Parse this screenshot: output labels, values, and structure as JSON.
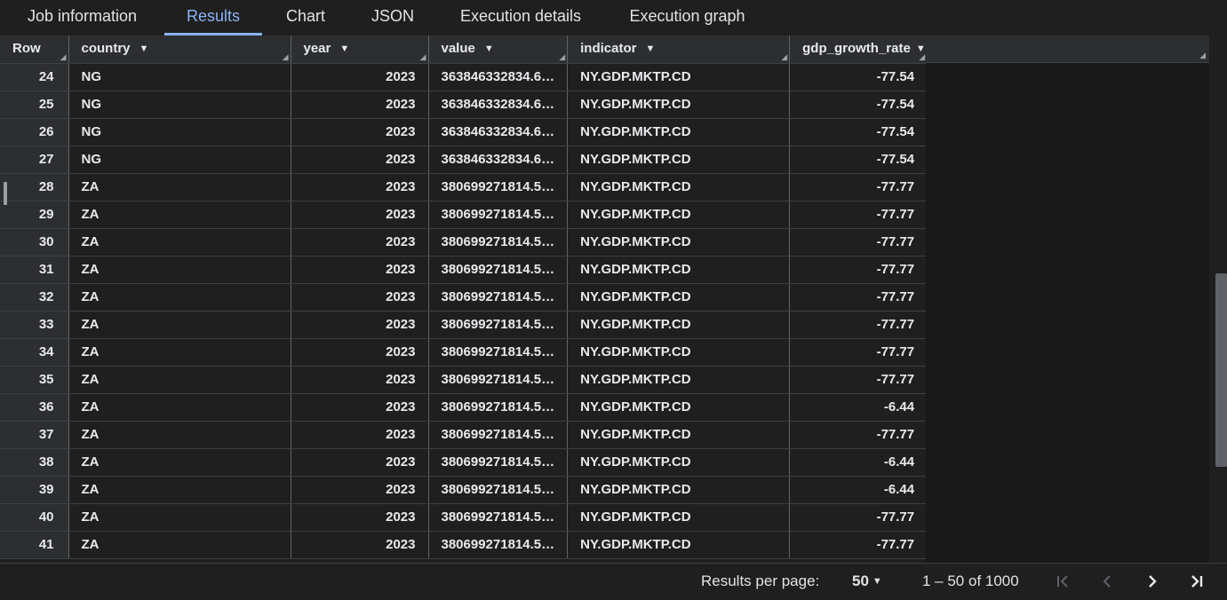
{
  "tabs": [
    {
      "label": "Job information"
    },
    {
      "label": "Results"
    },
    {
      "label": "Chart"
    },
    {
      "label": "JSON"
    },
    {
      "label": "Execution details"
    },
    {
      "label": "Execution graph"
    }
  ],
  "table": {
    "columns": [
      "Row",
      "country",
      "year",
      "value",
      "indicator",
      "gdp_growth_rate"
    ],
    "rows": [
      [
        "24",
        "NG",
        "2023",
        "363846332834.6…",
        "NY.GDP.MKTP.CD",
        "-77.54"
      ],
      [
        "25",
        "NG",
        "2023",
        "363846332834.6…",
        "NY.GDP.MKTP.CD",
        "-77.54"
      ],
      [
        "26",
        "NG",
        "2023",
        "363846332834.6…",
        "NY.GDP.MKTP.CD",
        "-77.54"
      ],
      [
        "27",
        "NG",
        "2023",
        "363846332834.6…",
        "NY.GDP.MKTP.CD",
        "-77.54"
      ],
      [
        "28",
        "ZA",
        "2023",
        "380699271814.5…",
        "NY.GDP.MKTP.CD",
        "-77.77"
      ],
      [
        "29",
        "ZA",
        "2023",
        "380699271814.5…",
        "NY.GDP.MKTP.CD",
        "-77.77"
      ],
      [
        "30",
        "ZA",
        "2023",
        "380699271814.5…",
        "NY.GDP.MKTP.CD",
        "-77.77"
      ],
      [
        "31",
        "ZA",
        "2023",
        "380699271814.5…",
        "NY.GDP.MKTP.CD",
        "-77.77"
      ],
      [
        "32",
        "ZA",
        "2023",
        "380699271814.5…",
        "NY.GDP.MKTP.CD",
        "-77.77"
      ],
      [
        "33",
        "ZA",
        "2023",
        "380699271814.5…",
        "NY.GDP.MKTP.CD",
        "-77.77"
      ],
      [
        "34",
        "ZA",
        "2023",
        "380699271814.5…",
        "NY.GDP.MKTP.CD",
        "-77.77"
      ],
      [
        "35",
        "ZA",
        "2023",
        "380699271814.5…",
        "NY.GDP.MKTP.CD",
        "-77.77"
      ],
      [
        "36",
        "ZA",
        "2023",
        "380699271814.5…",
        "NY.GDP.MKTP.CD",
        "-6.44"
      ],
      [
        "37",
        "ZA",
        "2023",
        "380699271814.5…",
        "NY.GDP.MKTP.CD",
        "-77.77"
      ],
      [
        "38",
        "ZA",
        "2023",
        "380699271814.5…",
        "NY.GDP.MKTP.CD",
        "-6.44"
      ],
      [
        "39",
        "ZA",
        "2023",
        "380699271814.5…",
        "NY.GDP.MKTP.CD",
        "-6.44"
      ],
      [
        "40",
        "ZA",
        "2023",
        "380699271814.5…",
        "NY.GDP.MKTP.CD",
        "-77.77"
      ],
      [
        "41",
        "ZA",
        "2023",
        "380699271814.5…",
        "NY.GDP.MKTP.CD",
        "-77.77"
      ]
    ]
  },
  "footer": {
    "results_per_page_label": "Results per page:",
    "results_per_page_value": "50",
    "range_text": "1 – 50 of 1000"
  },
  "icons": {
    "sort": "arrow-drop-down-icon",
    "first": "first-page-icon",
    "prev": "chevron-left-icon",
    "next": "chevron-right-icon",
    "last": "last-page-icon"
  },
  "colors": {
    "accent": "#8ab4f8",
    "background": "#1f1f1f",
    "header": "#2d2e30"
  }
}
